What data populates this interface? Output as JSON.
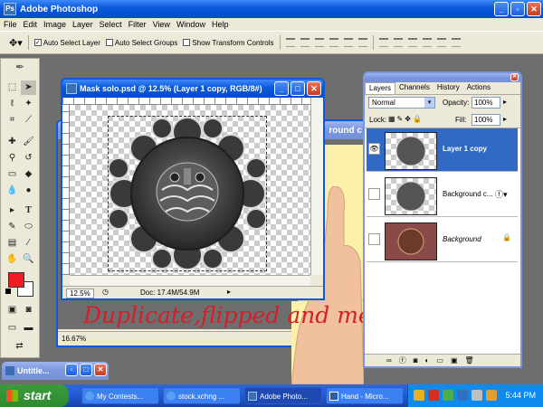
{
  "app": {
    "title": "Adobe Photoshop"
  },
  "menu": [
    "File",
    "Edit",
    "Image",
    "Layer",
    "Select",
    "Filter",
    "View",
    "Window",
    "Help"
  ],
  "options": {
    "auto_select_layer": {
      "label": "Auto Select Layer",
      "checked": true
    },
    "auto_select_groups": {
      "label": "Auto Select Groups",
      "checked": false
    },
    "show_transform": {
      "label": "Show Transform Controls",
      "checked": false
    }
  },
  "doc_main": {
    "title": "Mask solo.psd @ 12.5% (Layer 1 copy, RGB/8#)",
    "zoom": "12.5%",
    "docinfo": "Doc: 17.4M/54.9M"
  },
  "doc_back": {
    "title_fragment": "round c",
    "zoom": "16.67%"
  },
  "doc_untitled": {
    "title": "Untitle..."
  },
  "annotation": "Duplicate,flipped and merged",
  "layers": {
    "tabs": [
      "Layers",
      "Channels",
      "History",
      "Actions"
    ],
    "blend_mode": "Normal",
    "opacity_label": "Opacity:",
    "opacity": "100%",
    "lock_label": "Lock:",
    "fill_label": "Fill:",
    "fill": "100%",
    "items": [
      {
        "name": "Layer 1 copy",
        "visible": true,
        "selected": true
      },
      {
        "name": "Background c...",
        "visible": false,
        "selected": false
      },
      {
        "name": "Background",
        "visible": false,
        "selected": false
      }
    ]
  },
  "taskbar": {
    "start": "start",
    "tasks": [
      "My Contests...",
      "stock.xchng ...",
      "Adobe Photo...",
      "Hand - Micro..."
    ],
    "clock": "5:44 PM"
  },
  "colors": {
    "foreground": "#ee1c24",
    "background": "#ffffff",
    "selection": "#316ac5",
    "annotation": "#d61e2a"
  }
}
